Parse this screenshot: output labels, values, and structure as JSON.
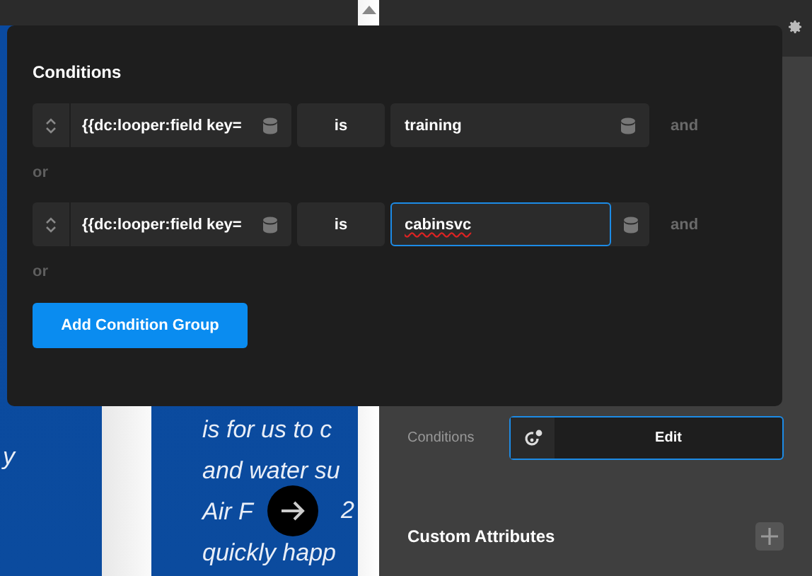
{
  "canvas": {
    "left_card_text": [
      "y"
    ],
    "card_lines": [
      {
        "parts": [
          "is for us to c"
        ]
      },
      {
        "parts": [
          "and water su"
        ]
      },
      {
        "parts": [
          "Air F",
          "2"
        ]
      },
      {
        "parts": [
          "quickly happ"
        ]
      }
    ]
  },
  "modal": {
    "title": "Conditions",
    "groups": [
      {
        "field": "{{dc:looper:field key=",
        "operator": "is",
        "value": "training",
        "focused": false,
        "joiner": "and",
        "separator": "or"
      },
      {
        "field": "{{dc:looper:field key=",
        "operator": "is",
        "value": "cabinsvc",
        "focused": true,
        "joiner": "and",
        "separator": "or"
      }
    ],
    "add_button": "Add Condition Group"
  },
  "panel": {
    "conditions_label": "Conditions",
    "edit_button": "Edit",
    "section_title": "Custom Attributes"
  }
}
